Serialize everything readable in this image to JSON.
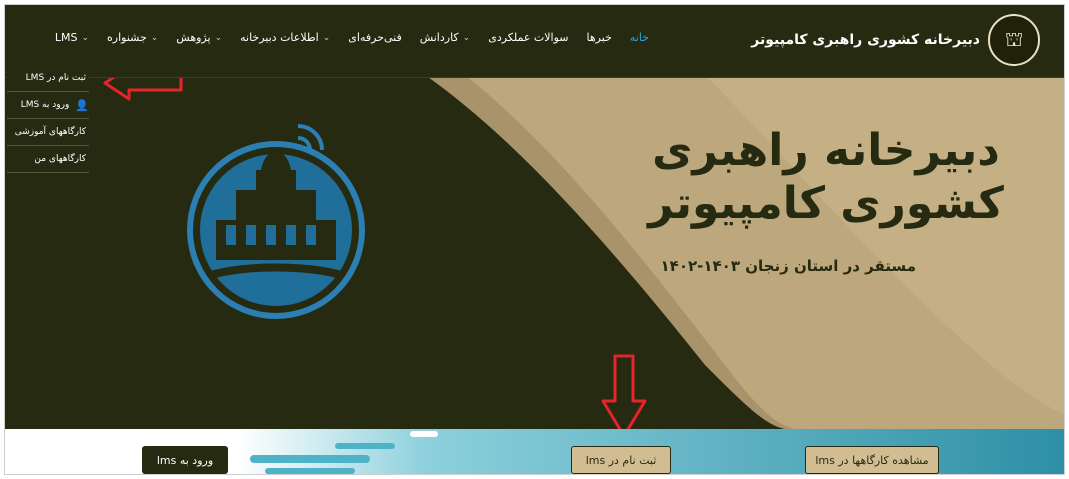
{
  "brand": {
    "title": "دبیرخانه کشوری راهبری کامپیوتر"
  },
  "nav": {
    "items": [
      {
        "label": "خانه",
        "has_dropdown": false,
        "active": true
      },
      {
        "label": "خبرها",
        "has_dropdown": false,
        "active": false
      },
      {
        "label": "سوالات عملکردی",
        "has_dropdown": false,
        "active": false
      },
      {
        "label": "کاردانش",
        "has_dropdown": true,
        "active": false
      },
      {
        "label": "فنی‌حرفه‌ای",
        "has_dropdown": false,
        "active": false
      },
      {
        "label": "اطلاعات دبیرخانه",
        "has_dropdown": true,
        "active": false
      },
      {
        "label": "پژوهش",
        "has_dropdown": true,
        "active": false
      },
      {
        "label": "جشنواره",
        "has_dropdown": true,
        "active": false
      },
      {
        "label": "LMS",
        "has_dropdown": true,
        "active": false
      }
    ]
  },
  "lms_dropdown": {
    "items": [
      {
        "label": "ثبت نام در LMS"
      },
      {
        "label": "ورود به LMS",
        "icon": "user-icon"
      },
      {
        "label": "کارگاههای آموزشی"
      },
      {
        "label": "کارگاههای من"
      }
    ]
  },
  "hero": {
    "title": "دبیرخانه راهبری کشوری کامپیوتر",
    "subtitle": "مستقر در استان زنجان ۱۴۰۳-۱۴۰۲"
  },
  "buttons": {
    "login": "ورود به lms",
    "register": "ثبت نام در lms",
    "workshops": "مشاهده کارگاهها در lms"
  },
  "colors": {
    "dark": "#262a10",
    "beige": "#bda87e",
    "beige_light": "#cfbb90",
    "teal": "#2e8fa6",
    "accent_red": "#e5242b",
    "active_link": "#29a9e0"
  }
}
